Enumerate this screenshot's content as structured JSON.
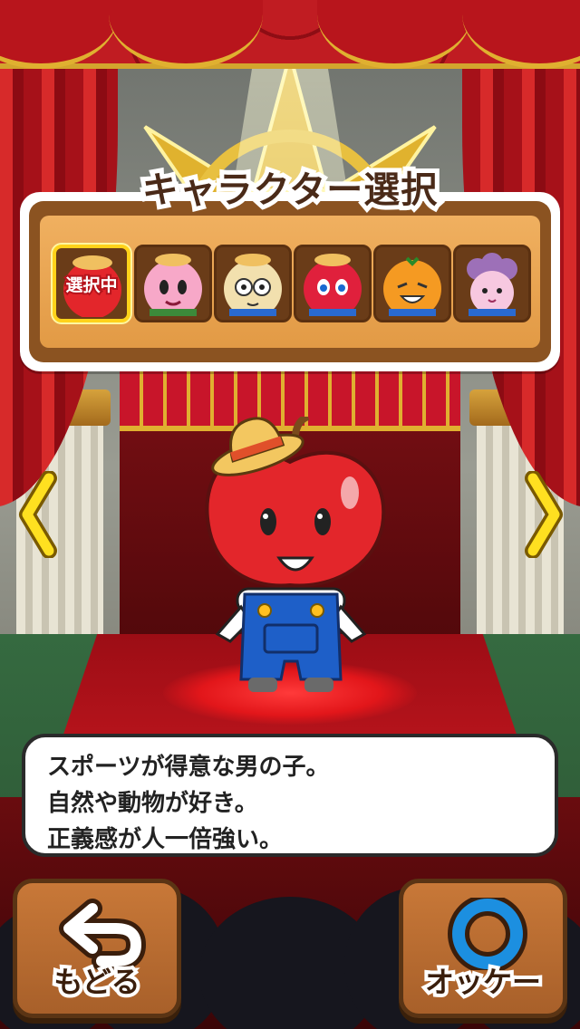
{
  "header": {
    "title": "キャラクター選択"
  },
  "characters": {
    "selected_badge": "選択中",
    "items": [
      {
        "name": "apple",
        "color": "#e3262b"
      },
      {
        "name": "peach",
        "color": "#f7a8c8"
      },
      {
        "name": "pear",
        "color": "#f2e0ae"
      },
      {
        "name": "strawberry",
        "color": "#e0203c"
      },
      {
        "name": "orange",
        "color": "#f59a22"
      },
      {
        "name": "grape",
        "color": "#9d70b8"
      }
    ]
  },
  "description": {
    "line1": "スポーツが得意な男の子。",
    "line2": "自然や動物が好き。",
    "line3": "正義感が人一倍強い。"
  },
  "buttons": {
    "back_label": "もどる",
    "ok_label": "オッケー"
  },
  "icons": {
    "prev": "chevron-left-icon",
    "next": "chevron-right-icon",
    "back": "undo-arrow-icon",
    "ok": "circle-o-icon"
  },
  "colors": {
    "accent_yellow": "#ffd21a",
    "ok_blue": "#1c8fe0",
    "wood": "#a8602a"
  }
}
